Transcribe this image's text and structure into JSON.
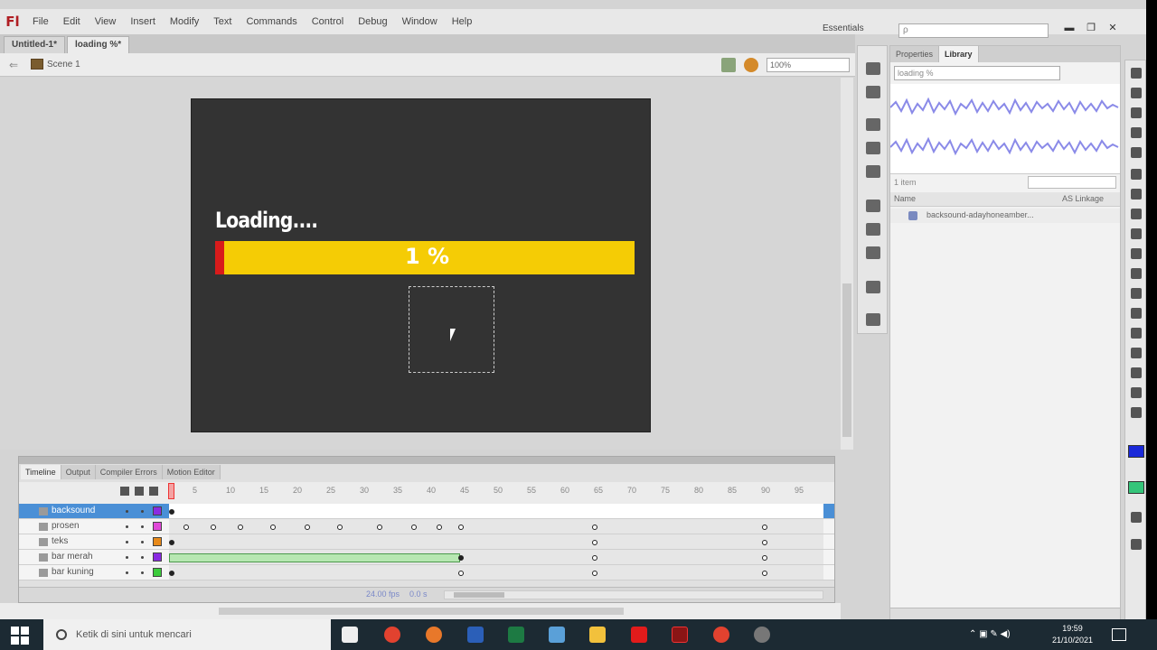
{
  "menu": {
    "logo": "Fl",
    "items": [
      "File",
      "Edit",
      "View",
      "Insert",
      "Modify",
      "Text",
      "Commands",
      "Control",
      "Debug",
      "Window",
      "Help"
    ],
    "workspace": "Essentials",
    "help_search_placeholder": "ρ"
  },
  "window_controls": {
    "minimize": "▬",
    "restore": "❐",
    "close": "✕"
  },
  "doc_tabs": [
    "Untitled-1*",
    "loading %*"
  ],
  "editbar": {
    "scene": "Scene 1",
    "zoom": "100%",
    "back": "⇐"
  },
  "stage": {
    "loading_text": "Loading....",
    "percent_text": "1 %",
    "colors": {
      "bg": "#333333",
      "bar": "#f5cc05",
      "bar_start": "#d81b1b"
    }
  },
  "timeline": {
    "tabs": [
      "Timeline",
      "Output",
      "Compiler Errors",
      "Motion Editor"
    ],
    "frame_numbers": [
      "5",
      "10",
      "15",
      "20",
      "25",
      "30",
      "35",
      "40",
      "45",
      "50",
      "55",
      "60",
      "65",
      "70",
      "75",
      "80",
      "85",
      "90",
      "95"
    ],
    "layers": [
      {
        "name": "backsound",
        "selected": true,
        "color": "#8a2be2"
      },
      {
        "name": "prosen",
        "selected": false,
        "color": "#e048d8"
      },
      {
        "name": "teks",
        "selected": false,
        "color": "#e88a1a"
      },
      {
        "name": "bar merah",
        "selected": false,
        "color": "#8a2be2"
      },
      {
        "name": "bar kuning",
        "selected": false,
        "color": "#3ccc3c"
      }
    ],
    "fps": "24.00 fps",
    "time": "0.0 s",
    "current_frame": "1"
  },
  "panel": {
    "tabs": [
      "Properties",
      "Library"
    ],
    "library_select": "loading %",
    "item_count": "1 item",
    "columns": {
      "name": "Name",
      "linkage": "AS Linkage"
    },
    "items": [
      "backsound-adayhoneamber..."
    ]
  },
  "taskbar": {
    "search_placeholder": "Ketik di sini untuk mencari",
    "time": "19:59",
    "date": "21/10/2021"
  }
}
